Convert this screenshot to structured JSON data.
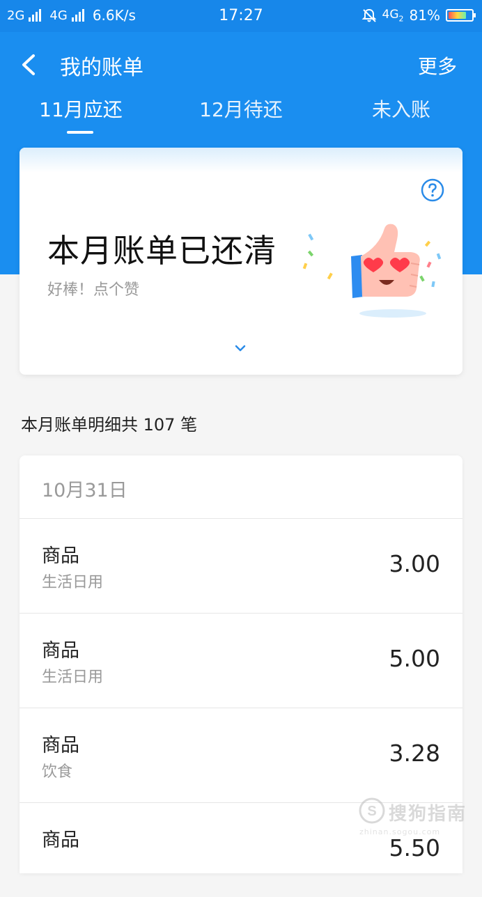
{
  "status_bar": {
    "net1": "2G",
    "net2": "4G",
    "speed": "6.6K/s",
    "time": "17:27",
    "net3": "4G",
    "net3_sub": "2",
    "battery": "81%",
    "battery_level": 0.81
  },
  "nav": {
    "title": "我的账单",
    "more": "更多"
  },
  "tabs": [
    {
      "label": "11月应还",
      "active": true
    },
    {
      "label": "12月待还",
      "active": false
    },
    {
      "label": "未入账",
      "active": false
    }
  ],
  "summary": {
    "title": "本月账单已还清",
    "subtitle": "好棒！点个赞"
  },
  "detail": {
    "count_label": "本月账单明细共 107 笔",
    "date": "10月31日",
    "items": [
      {
        "name": "商品",
        "category": "生活日用",
        "amount": "3.00"
      },
      {
        "name": "商品",
        "category": "生活日用",
        "amount": "5.00"
      },
      {
        "name": "商品",
        "category": "饮食",
        "amount": "3.28"
      },
      {
        "name": "商品",
        "category": "",
        "amount": "5.50"
      }
    ]
  },
  "watermark": {
    "text": "搜狗指南",
    "url": "zhinan.sogou.com"
  },
  "colors": {
    "primary": "#1a8ef0",
    "help": "#2a8be8"
  }
}
